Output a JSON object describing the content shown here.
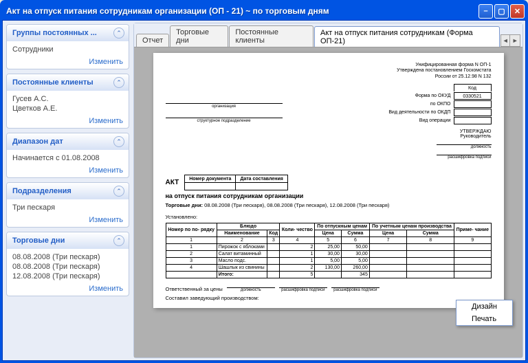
{
  "window": {
    "title": "Акт на отпуск питания сотрудникам организации (ОП - 21) ~ по торговым дням"
  },
  "sidebar": {
    "change_label": "Изменить",
    "groups": {
      "title": "Группы постоянных ...",
      "items": [
        "Сотрудники"
      ]
    },
    "clients": {
      "title": "Постоянные клиенты",
      "items": [
        "Гусев А.С.",
        "Цветков А.Е."
      ]
    },
    "dates": {
      "title": "Диапазон дат",
      "items": [
        "Начинается с 01.08.2008"
      ]
    },
    "dept": {
      "title": "Подразделения",
      "items": [
        "Три пескаря"
      ]
    },
    "days": {
      "title": "Торговые дни",
      "items": [
        "08.08.2008 (Три пескаря)",
        "08.08.2008 (Три пескаря)",
        "12.08.2008 (Три пескаря)"
      ]
    }
  },
  "tabs": {
    "items": [
      "Отчет",
      "Торговые дни",
      "Постоянные клиенты",
      "Акт на отпуск питания сотрудникам (Форма ОП-21)"
    ],
    "active": 3
  },
  "doc": {
    "form_line1": "Унифицированная форма N ОП-1",
    "form_line2": "Утверждена постановлением Госкомстата",
    "form_line3": "России от 25.12.98 N 132",
    "kod_label": "Код",
    "okud_label": "Форма по ОКУД",
    "okud_value": "0330521",
    "okpo_label": "по ОКПО",
    "okdp_label": "Вид деятельности по ОКДП",
    "oper_label": "Вид операции",
    "org_cap": "организация",
    "struct_cap": "структурное подразделение",
    "approve1": "УТВЕРЖДАЮ",
    "approve2": "Руководитель",
    "dolzh_cap": "должность",
    "sign_cap": "расшифровка подписи",
    "akt": "АКТ",
    "num_label": "Номер документа",
    "date_label": "Дата составления",
    "title": "на отпуск питания сотрудникам организации",
    "torg_label": "Торговые дни:",
    "torg_value": "08.08.2008 (Три пескаря), 08.08.2008 (Три пескаря), 12.08.2008 (Три пескаря)",
    "ust": "Установлено:",
    "th": {
      "nom": "Номер по по- рядку",
      "bludo": "Блюдо",
      "kol": "Коли- чество",
      "otpusk": "По отпускным ценам",
      "uchet": "По учетным ценам производства",
      "prim": "Приме- чание",
      "naim": "Наименование",
      "kod": "Код",
      "cena": "Цена",
      "summa": "Сумма"
    },
    "colnums": [
      "1",
      "2",
      "3",
      "4",
      "5",
      "6",
      "7",
      "8",
      "9"
    ],
    "rows": [
      {
        "n": "1",
        "name": "Пирожок с яблоками",
        "kod": "",
        "kol": "2",
        "c1": "25,00",
        "s1": "50,00",
        "c2": "",
        "s2": ""
      },
      {
        "n": "2",
        "name": "Салат витаминный",
        "kod": "",
        "kol": "1",
        "c1": "30,00",
        "s1": "30,00",
        "c2": "",
        "s2": ""
      },
      {
        "n": "3",
        "name": "Масло подс.",
        "kod": "",
        "kol": "1",
        "c1": "5,00",
        "s1": "5,00",
        "c2": "",
        "s2": ""
      },
      {
        "n": "4",
        "name": "Шашлык из свинины",
        "kod": "",
        "kol": "2",
        "c1": "130,00",
        "s1": "260,00",
        "c2": "",
        "s2": ""
      }
    ],
    "itogo_label": "Итого:",
    "itogo_kol": "5",
    "itogo_sum": "345",
    "resp_label": "Ответственный за цены",
    "zav_label": "Составил заведующий производством:"
  },
  "context": {
    "design": "Дизайн",
    "print": "Печать"
  }
}
